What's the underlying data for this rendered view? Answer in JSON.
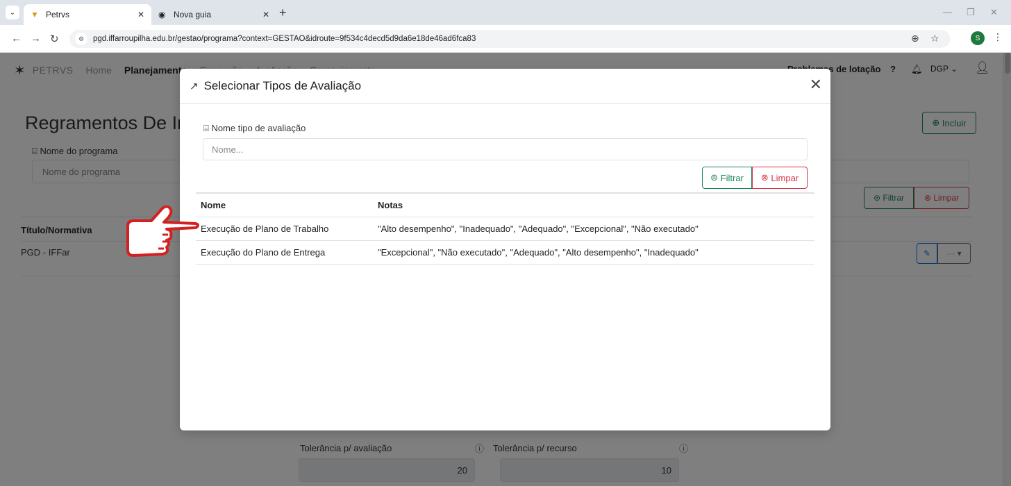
{
  "browser": {
    "tabs": [
      {
        "label": "Petrvs",
        "active": true
      },
      {
        "label": "Nova guia",
        "active": false
      }
    ],
    "url": "pgd.iffarroupilha.edu.br/gestao/programa?context=GESTAO&idroute=9f534c4decd5d9da6e18de46ad6fca83",
    "profile_initial": "S"
  },
  "topnav": {
    "brand": "PETRVS",
    "links": [
      "Home",
      "Planejamento",
      "Execução",
      "Avaliação",
      "Gerenciamento"
    ],
    "right_text": "Problemas de lotação",
    "help": "?",
    "unit": "DGP"
  },
  "page": {
    "title": "Regramentos De Instituição",
    "incluir_label": "Incluir",
    "filter_label": "Nome do programa",
    "filter_placeholder": "Nome do programa",
    "filtrar_label": "Filtrar",
    "limpar_label": "Limpar",
    "table_header": "Título/Normativa",
    "rows": [
      "PGD - IFFar"
    ],
    "tolerancia_avaliacao_label": "Tolerância p/ avaliação",
    "tolerancia_avaliacao_value": "20",
    "tolerancia_recurso_label": "Tolerância p/ recurso",
    "tolerancia_recurso_value": "10"
  },
  "modal": {
    "title": "Selecionar Tipos de Avaliação",
    "field_label": "Nome tipo de avaliação",
    "field_placeholder": "Nome...",
    "filtrar_label": "Filtrar",
    "limpar_label": "Limpar",
    "columns": [
      "Nome",
      "Notas"
    ],
    "rows": [
      {
        "nome": "Execução de Plano de Trabalho",
        "notas": "\"Alto desempenho\", \"Inadequado\", \"Adequado\", \"Excepcional\", \"Não executado\""
      },
      {
        "nome": "Execução do Plano de Entrega",
        "notas": "\"Excepcional\", \"Não executado\", \"Adequado\", \"Alto desempenho\", \"Inadequado\""
      }
    ]
  },
  "colors": {
    "success": "#198754",
    "danger": "#dc3545",
    "primary": "#0d6efd",
    "pointer_outline": "#d42020"
  }
}
